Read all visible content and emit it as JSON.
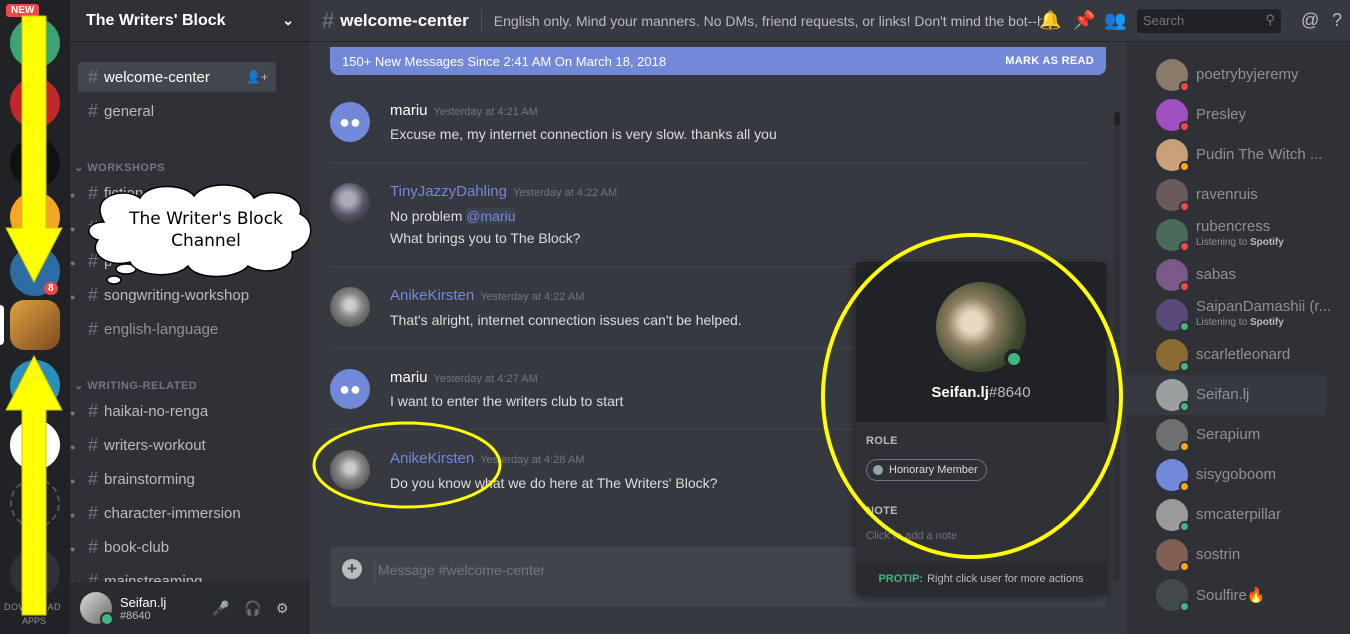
{
  "rail": {
    "new_badge": "NEW",
    "unread_badge": "8",
    "download_label": "DOWNLOAD",
    "apps_label": "APPS"
  },
  "server": {
    "name": "The Writers' Block"
  },
  "channels": {
    "top": [
      {
        "name": "welcome-center",
        "active": true
      },
      {
        "name": "general"
      }
    ],
    "workshops_category": "WORKSHOPS",
    "workshops": [
      "fiction-w",
      "p",
      "p",
      "songwriting-workshop",
      "english-language"
    ],
    "writing_category": "WRITING-RELATED",
    "writing": [
      "haikai-no-renga",
      "writers-workout",
      "brainstorming",
      "character-immersion",
      "book-club",
      "mainstreaming"
    ]
  },
  "user": {
    "name": "Seifan.lj",
    "tag": "#8640"
  },
  "topbar": {
    "channel": "welcome-center",
    "topic": "English only. Mind your manners. No DMs, friend requests, or links! Don't mind the bot--h...",
    "search_placeholder": "Search"
  },
  "newbar": {
    "text": "150+ New Messages Since 2:41 AM On March 18, 2018",
    "mark_read": "MARK AS READ"
  },
  "messages": [
    {
      "author": "mariu",
      "time": "Yesterday at 4:21 AM",
      "lines": [
        "Excuse me, my internet connection is very slow. thanks all you"
      ]
    },
    {
      "author": "TinyJazzyDahling",
      "time": "Yesterday at 4:22 AM",
      "line1_text": "No problem ",
      "line1_mention": "@mariu",
      "line2": "What brings you to The Block?"
    },
    {
      "author": "AnikeKirsten",
      "time": "Yesterday at 4:22 AM",
      "lines": [
        "That's alright, internet connection issues can't be helped."
      ]
    },
    {
      "author": "mariu",
      "time": "Yesterday at 4:27 AM",
      "lines": [
        "I want to enter the writers club to start"
      ]
    },
    {
      "author": "AnikeKirsten",
      "time": "Yesterday at 4:28 AM",
      "lines": [
        "Do you know what we do here at The Writers' Block?"
      ]
    }
  ],
  "composer": {
    "placeholder": "Message #welcome-center"
  },
  "members": [
    {
      "name": "poetrybyjeremy",
      "status": "dnd"
    },
    {
      "name": "Presley",
      "status": "dnd"
    },
    {
      "name": "Pudin The Witch ...",
      "status": "idle"
    },
    {
      "name": "ravenruis",
      "status": "dnd"
    },
    {
      "name": "rubencress",
      "status": "dnd",
      "activity_prefix": "Listening to ",
      "activity_app": "Spotify"
    },
    {
      "name": "sabas",
      "status": "dnd"
    },
    {
      "name": "SaipanDamashii (r...",
      "status": "online",
      "activity_prefix": "Listening to ",
      "activity_app": "Spotify"
    },
    {
      "name": "scarletleonard",
      "status": "online"
    },
    {
      "name": "Seifan.lj",
      "status": "online",
      "selected": true
    },
    {
      "name": "Serapium",
      "status": "idle"
    },
    {
      "name": "sisygoboom",
      "status": "idle"
    },
    {
      "name": "smcaterpillar",
      "status": "online"
    },
    {
      "name": "sostrin",
      "status": "idle"
    },
    {
      "name": "Soulfire🔥",
      "status": "online"
    }
  ],
  "status_colors": {
    "online": "#43b581",
    "idle": "#faa61a",
    "dnd": "#f04747"
  },
  "popout": {
    "name": "Seifan.lj",
    "tag": "#8640",
    "role_label": "ROLE",
    "role": "Honorary Member",
    "note_label": "NOTE",
    "note_placeholder": "Click to add a note",
    "protip_label": "PROTIP:",
    "protip_text": "Right click user for more actions"
  },
  "annotation": {
    "bubble_line1": "The Writer's Block",
    "bubble_line2": "Channel",
    "highlight_color": "#ffff00"
  }
}
